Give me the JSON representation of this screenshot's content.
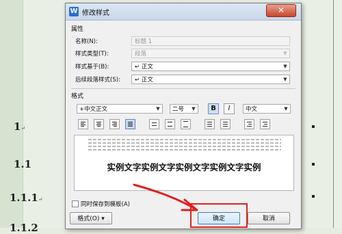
{
  "document": {
    "headings": [
      "1",
      "1.1",
      "1.1.1",
      "1.1.2"
    ],
    "return_mark": "↵"
  },
  "dialog": {
    "title": "修改样式",
    "app_icon_letter": "W",
    "close_symbol": "✕",
    "properties": {
      "group_label": "属性",
      "name_label": "名称(N):",
      "name_value": "标题 1",
      "type_label": "样式类型(T):",
      "type_value": "段落",
      "based_on_label": "样式基于(B):",
      "based_on_value": "↵ 正文",
      "next_style_label": "后续段落样式(S):",
      "next_style_value": "↵ 正文"
    },
    "format": {
      "group_label": "格式",
      "font": "+中文正文",
      "size": "二号",
      "bold": "B",
      "italic": "I",
      "language": "中文",
      "dropdown_arrow": "▼"
    },
    "preview": {
      "sample_text": "实例文字实例文字实例文字实例文字实例"
    },
    "save_to_template_label": "同时保存到模板(A)",
    "save_to_template_checked": false,
    "format_menu_button": "格式(O) ▾",
    "ok_button": "确定",
    "cancel_button": "取消"
  },
  "colors": {
    "annotation_red": "#e02020",
    "accent_blue": "#2a6ed6"
  }
}
